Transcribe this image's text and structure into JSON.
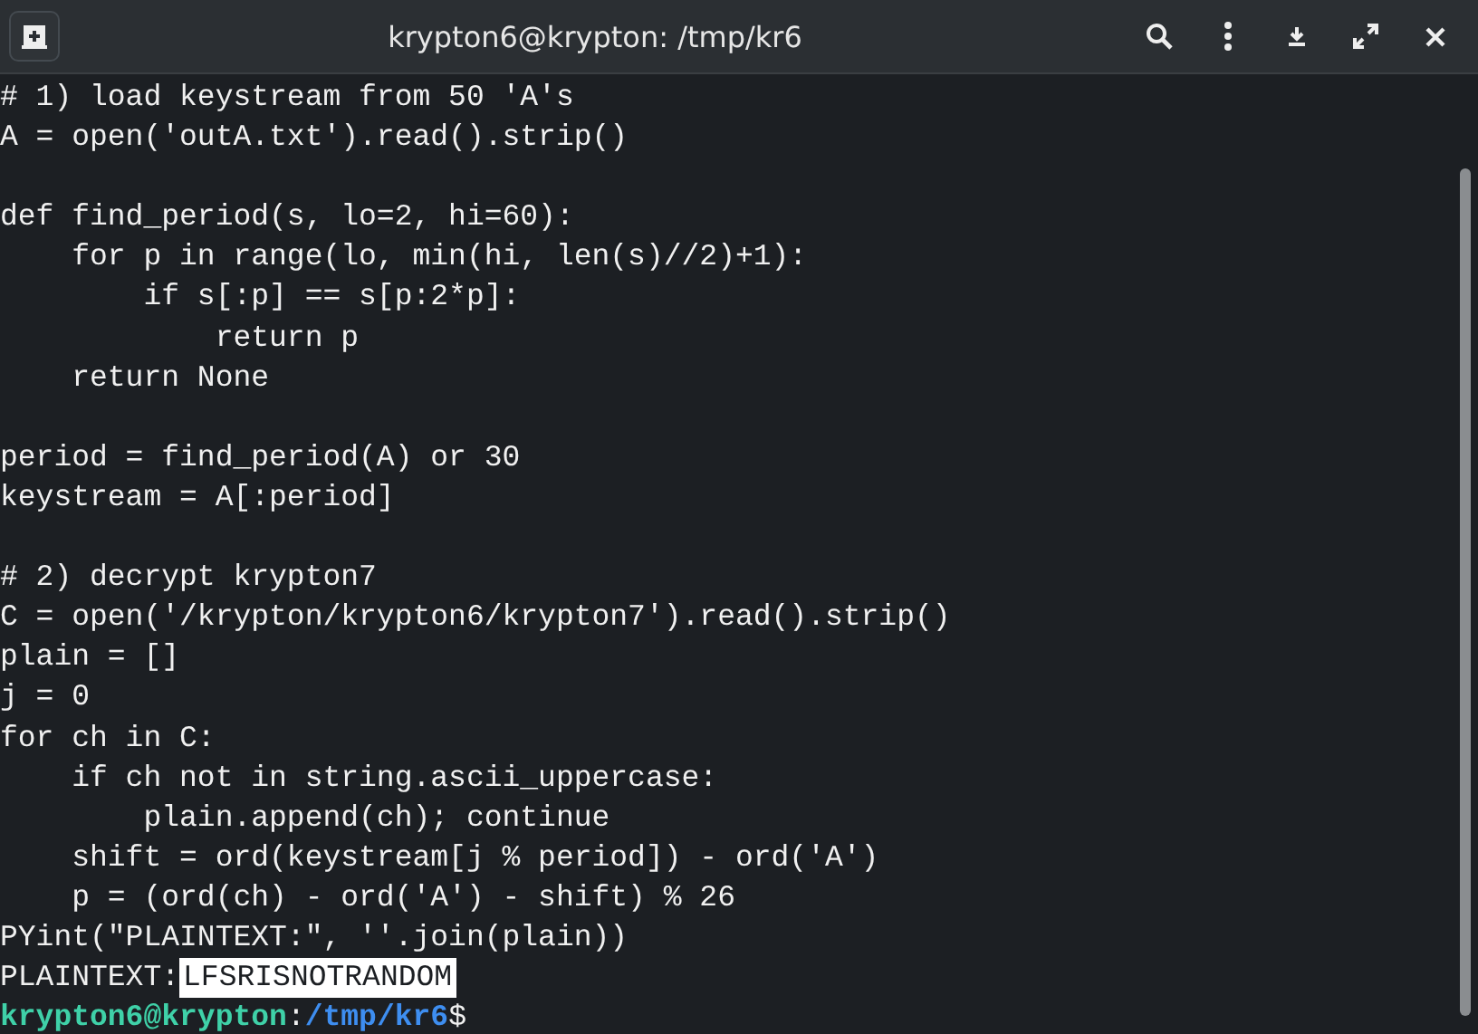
{
  "window": {
    "title": "krypton6@krypton: /tmp/kr6"
  },
  "lines": [
    {
      "kind": "text",
      "text": "# 1) load keystream from 50 'A's"
    },
    {
      "kind": "text",
      "text": "A = open('outA.txt').read().strip()"
    },
    {
      "kind": "blank"
    },
    {
      "kind": "text",
      "text": "def find_period(s, lo=2, hi=60):"
    },
    {
      "kind": "text",
      "text": "    for p in range(lo, min(hi, len(s)//2)+1):"
    },
    {
      "kind": "text",
      "text": "        if s[:p] == s[p:2*p]:"
    },
    {
      "kind": "text",
      "text": "            return p"
    },
    {
      "kind": "text",
      "text": "    return None"
    },
    {
      "kind": "blank"
    },
    {
      "kind": "text",
      "text": "period = find_period(A) or 30"
    },
    {
      "kind": "text",
      "text": "keystream = A[:period]"
    },
    {
      "kind": "blank"
    },
    {
      "kind": "text",
      "text": "# 2) decrypt krypton7"
    },
    {
      "kind": "text",
      "text": "C = open('/krypton/krypton6/krypton7').read().strip()"
    },
    {
      "kind": "text",
      "text": "plain = []"
    },
    {
      "kind": "text",
      "text": "j = 0"
    },
    {
      "kind": "text",
      "text": "for ch in C:"
    },
    {
      "kind": "text",
      "text": "    if ch not in string.ascii_uppercase:"
    },
    {
      "kind": "text",
      "text": "        plain.append(ch); continue"
    },
    {
      "kind": "text",
      "text": "    shift = ord(keystream[j % period]) - ord('A')"
    },
    {
      "kind": "text",
      "text": "    p = (ord(ch) - ord('A') - shift) % 26"
    },
    {
      "kind": "text",
      "text": "PYint(\"PLAINTEXT:\", ''.join(plain))"
    },
    {
      "kind": "output",
      "text": "PLAINTEXT:",
      "highlighted": "LFSRISNOTRANDOM"
    },
    {
      "kind": "prompt",
      "user_host": "krypton6@krypton",
      "separator": ":",
      "path": "/tmp/kr6",
      "symbol": "$"
    }
  ]
}
